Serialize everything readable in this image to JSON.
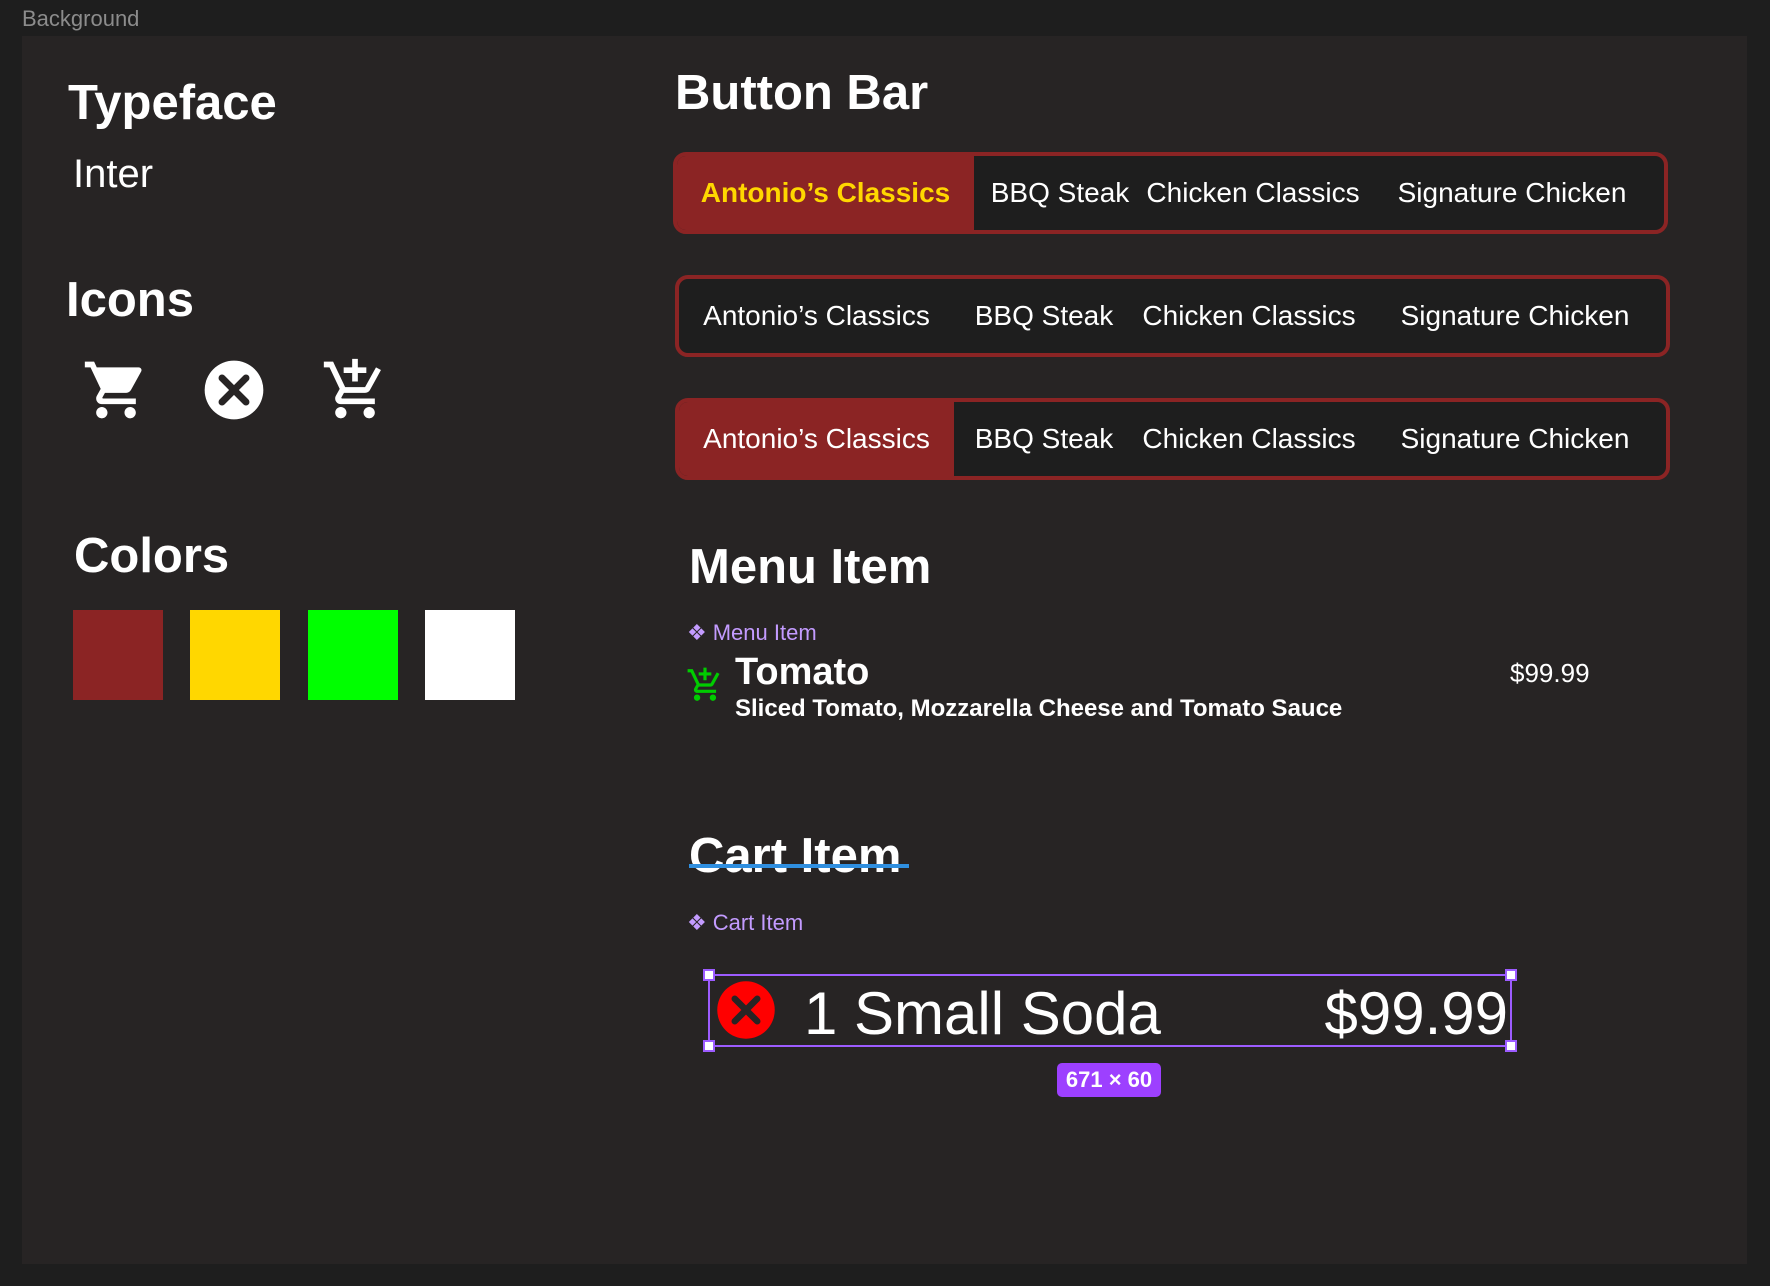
{
  "frame_label": "Background",
  "typeface": {
    "heading": "Typeface",
    "name": "Inter"
  },
  "icons": {
    "heading": "Icons",
    "items": [
      "cart-icon",
      "close-circle-icon",
      "add-to-cart-icon"
    ]
  },
  "colors": {
    "heading": "Colors",
    "swatches": [
      "#8b2424",
      "#ffd700",
      "#00ff00",
      "#ffffff"
    ]
  },
  "button_bar": {
    "heading": "Button Bar",
    "variants": [
      {
        "active_index": 0,
        "active_style": "yellow-bold",
        "items": [
          "Antonio’s Classics",
          "BBQ Steak",
          "Chicken Classics",
          "Signature Chicken"
        ]
      },
      {
        "active_index": null,
        "active_style": "none",
        "items": [
          "Antonio’s Classics",
          "BBQ Steak",
          "Chicken Classics",
          "Signature Chicken"
        ]
      },
      {
        "active_index": 0,
        "active_style": "filled",
        "items": [
          "Antonio’s Classics",
          "BBQ Steak",
          "Chicken Classics",
          "Signature Chicken"
        ]
      }
    ]
  },
  "menu_item": {
    "heading": "Menu Item",
    "component_label": "Menu Item",
    "name": "Tomato",
    "description": "Sliced Tomato, Mozzarella Cheese and Tomato Sauce",
    "price": "$99.99",
    "icon": "add-to-cart-icon",
    "icon_color": "#00cc00"
  },
  "cart_item": {
    "heading": "Cart Item",
    "component_label": "Cart Item",
    "text": "1 Small Soda",
    "price": "$99.99",
    "icon": "remove-icon",
    "icon_color": "#ff0000",
    "dimensions_badge": "671 × 60"
  }
}
